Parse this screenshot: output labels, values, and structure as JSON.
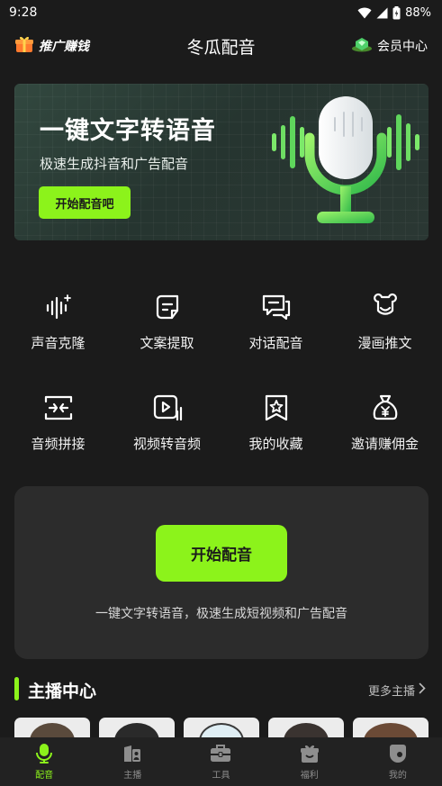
{
  "status": {
    "time": "9:28",
    "battery": "88%"
  },
  "header": {
    "promo_label": "推广赚钱",
    "title": "冬瓜配音",
    "member_label": "会员中心"
  },
  "banner": {
    "title": "一键文字转语音",
    "subtitle": "极速生成抖音和广告配音",
    "button": "开始配音吧"
  },
  "tools": [
    {
      "label": "声音克隆",
      "icon": "sound-wave-icon"
    },
    {
      "label": "文案提取",
      "icon": "document-icon"
    },
    {
      "label": "对话配音",
      "icon": "chat-icon"
    },
    {
      "label": "漫画推文",
      "icon": "bear-icon"
    },
    {
      "label": "音频拼接",
      "icon": "merge-icon"
    },
    {
      "label": "视频转音频",
      "icon": "video-icon"
    },
    {
      "label": "我的收藏",
      "icon": "star-bookmark-icon"
    },
    {
      "label": "邀请赚佣金",
      "icon": "money-bag-icon"
    }
  ],
  "start_card": {
    "button": "开始配音",
    "description": "一键文字转语音，极速生成短视频和广告配音"
  },
  "anchors": {
    "title": "主播中心",
    "more": "更多主播"
  },
  "nav": [
    {
      "label": "配音",
      "icon": "mic-icon",
      "active": true
    },
    {
      "label": "主播",
      "icon": "anchor-icon",
      "active": false
    },
    {
      "label": "工具",
      "icon": "toolbox-icon",
      "active": false
    },
    {
      "label": "福利",
      "icon": "gift-icon",
      "active": false
    },
    {
      "label": "我的",
      "icon": "profile-icon",
      "active": false
    }
  ],
  "colors": {
    "accent": "#8cf31b",
    "background": "#1b1b1b",
    "card": "#2c2c2c"
  }
}
